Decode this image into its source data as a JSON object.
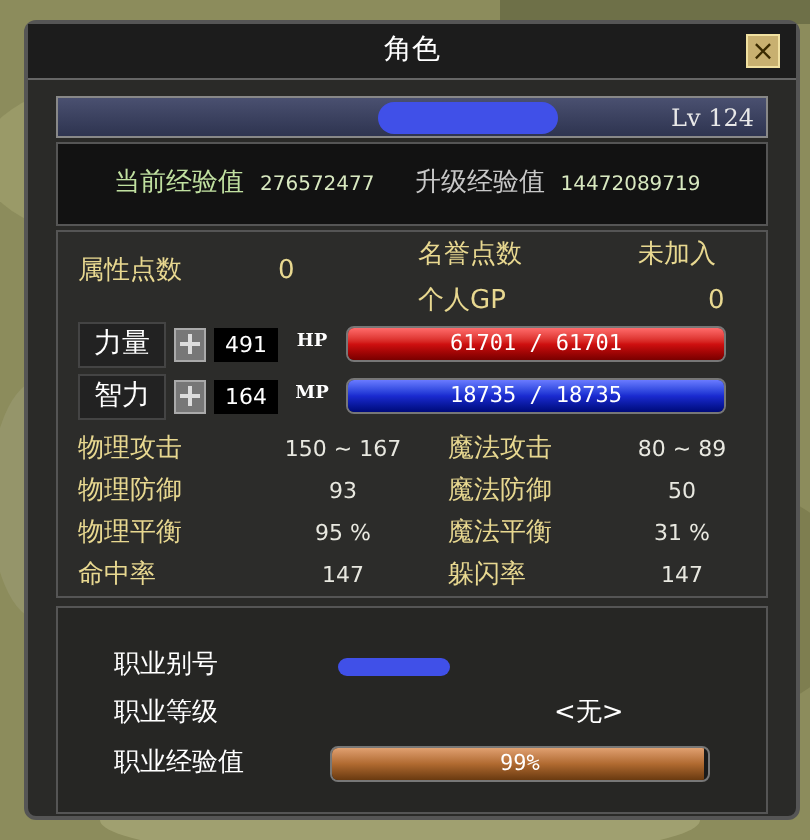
{
  "window": {
    "title": "角色",
    "close": "×"
  },
  "character": {
    "level": "Lv 124",
    "redacted": true
  },
  "experience": [
    {
      "label": "当前经验值",
      "value": "276572477",
      "kind": "current"
    },
    {
      "label": "升级经验值",
      "value": "14472089719",
      "kind": "next"
    }
  ],
  "points": {
    "attribute_label": "属性点数",
    "attribute_value": "0",
    "honor_label": "名誉点数",
    "honor_value": "未加入",
    "gp_label": "个人GP",
    "gp_value": "0"
  },
  "attributes": [
    {
      "name": "力量",
      "value": "491",
      "bar_label": "HP",
      "reading": "61701 / 61701",
      "level": 1.0,
      "kind": "hp"
    },
    {
      "name": "智力",
      "value": "164",
      "bar_label": "MP",
      "reading": "18735 / 18735",
      "level": 1.0,
      "kind": "mp"
    }
  ],
  "stats": [
    {
      "label": "物理攻击",
      "value": "150 ~ 167"
    },
    {
      "label": "魔法攻击",
      "value": "80 ~ 89"
    },
    {
      "label": "物理防御",
      "value": "93"
    },
    {
      "label": "魔法防御",
      "value": "50"
    },
    {
      "label": "物理平衡",
      "value": "95 %"
    },
    {
      "label": "魔法平衡",
      "value": "31 %"
    },
    {
      "label": "命中率",
      "value": "147"
    },
    {
      "label": "躲闪率",
      "value": "147"
    }
  ],
  "job": {
    "alias_label": "职业别号",
    "alias_redacted": true,
    "grade_label": "职业等级",
    "grade_value": "<无>",
    "exp_label": "职业经验值",
    "exp_reading": "99%",
    "level": 0.99
  }
}
